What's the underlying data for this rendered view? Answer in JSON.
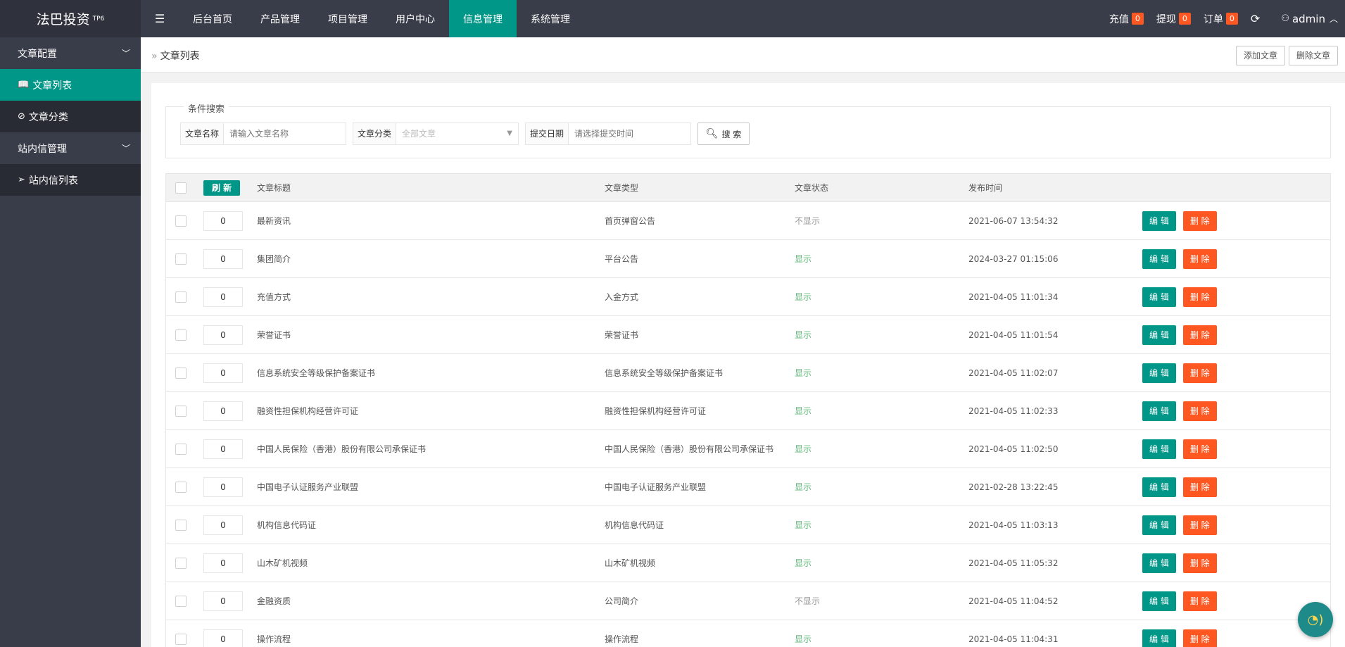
{
  "header": {
    "logo_text": "法巴投资",
    "logo_sup": "TP6",
    "menu_icon": "menu-fold-icon",
    "nav": [
      "后台首页",
      "产品管理",
      "项目管理",
      "用户中心",
      "信息管理",
      "系统管理"
    ],
    "active_nav": 4,
    "recharge_label": "充值",
    "recharge_count": "0",
    "withdraw_label": "提现",
    "withdraw_count": "0",
    "order_label": "订单",
    "order_count": "0",
    "username": "admin"
  },
  "sidebar": {
    "group1": "文章配置",
    "item_article_list": "文章列表",
    "item_article_category": "文章分类",
    "group2": "站内信管理",
    "item_message_list": "站内信列表"
  },
  "breadcrumb": {
    "current": "文章列表"
  },
  "toolbar": {
    "add_label": "添加文章",
    "delete_label": "删除文章"
  },
  "search": {
    "legend": "条件搜索",
    "name_label": "文章名称",
    "name_placeholder": "请输入文章名称",
    "category_label": "文章分类",
    "category_value": "全部文章",
    "date_label": "提交日期",
    "date_placeholder": "请选择提交时间",
    "button_label": "搜 索"
  },
  "table": {
    "refresh_label": "刷 新",
    "headers": {
      "title": "文章标题",
      "type": "文章类型",
      "status": "文章状态",
      "time": "发布时间"
    },
    "edit_label": "编 辑",
    "delete_label": "删 除",
    "rows": [
      {
        "sort": "0",
        "title": "最新资讯",
        "type": "首页弹窗公告",
        "status": "不显示",
        "time": "2021-06-07 13:54:32"
      },
      {
        "sort": "0",
        "title": "集团简介",
        "type": "平台公告",
        "status": "显示",
        "time": "2024-03-27 01:15:06"
      },
      {
        "sort": "0",
        "title": "充值方式",
        "type": "入金方式",
        "status": "显示",
        "time": "2021-04-05 11:01:34"
      },
      {
        "sort": "0",
        "title": "荣誉证书",
        "type": "荣誉证书",
        "status": "显示",
        "time": "2021-04-05 11:01:54"
      },
      {
        "sort": "0",
        "title": "信息系统安全等级保护备案证书",
        "type": "信息系统安全等级保护备案证书",
        "status": "显示",
        "time": "2021-04-05 11:02:07"
      },
      {
        "sort": "0",
        "title": "融资性担保机构经营许可证",
        "type": "融资性担保机构经营许可证",
        "status": "显示",
        "time": "2021-04-05 11:02:33"
      },
      {
        "sort": "0",
        "title": "中国人民保险（香港）股份有限公司承保证书",
        "type": "中国人民保险（香港）股份有限公司承保证书",
        "status": "显示",
        "time": "2021-04-05 11:02:50"
      },
      {
        "sort": "0",
        "title": "中国电子认证服务产业联盟",
        "type": "中国电子认证服务产业联盟",
        "status": "显示",
        "time": "2021-02-28 13:22:45"
      },
      {
        "sort": "0",
        "title": "机构信息代码证",
        "type": "机构信息代码证",
        "status": "显示",
        "time": "2021-04-05 11:03:13"
      },
      {
        "sort": "0",
        "title": "山木矿机视频",
        "type": "山木矿机视频",
        "status": "显示",
        "time": "2021-04-05 11:05:32"
      },
      {
        "sort": "0",
        "title": "金融资质",
        "type": "公司简介",
        "status": "不显示",
        "time": "2021-04-05 11:04:52"
      },
      {
        "sort": "0",
        "title": "操作流程",
        "type": "操作流程",
        "status": "显示",
        "time": "2021-04-05 11:04:31"
      }
    ]
  },
  "colors": {
    "accent": "#009688",
    "danger": "#ff5722",
    "dark": "#393d49",
    "show": "#5fb878",
    "hide": "#999999"
  }
}
